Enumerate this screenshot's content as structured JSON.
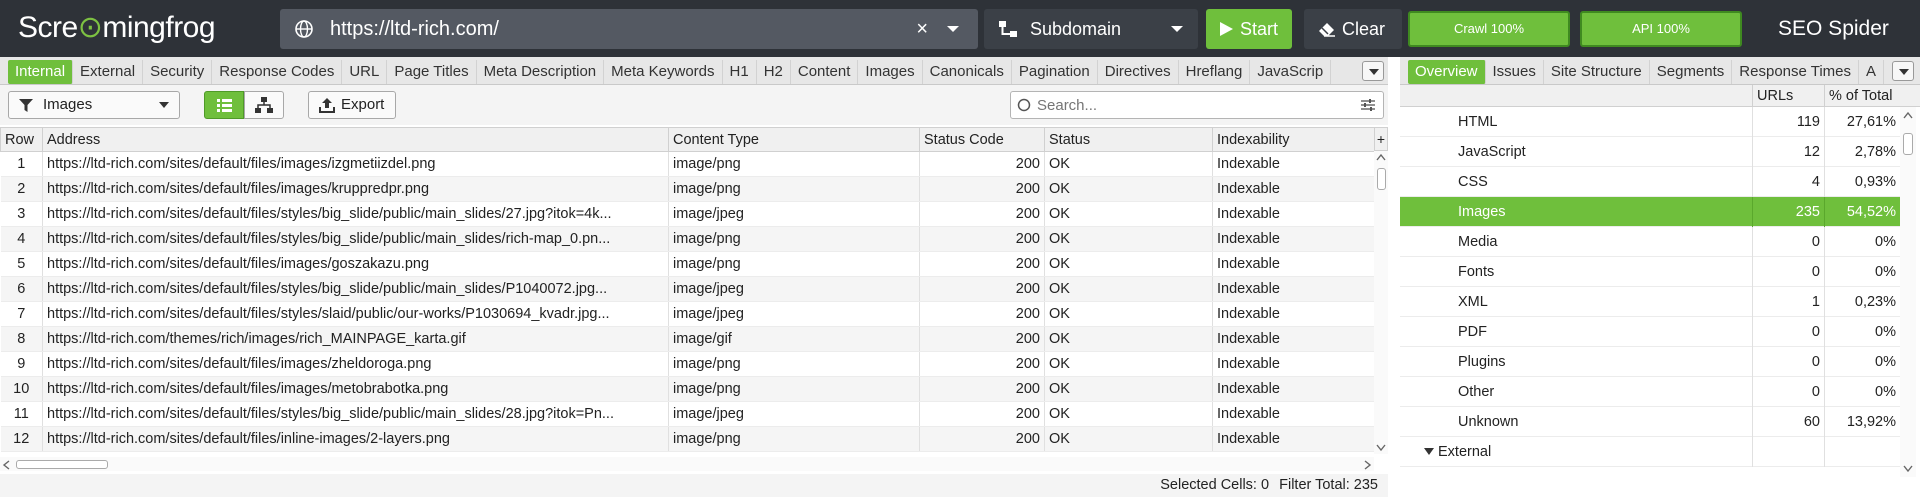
{
  "app": {
    "logo_prefix": "Scre",
    "logo_frog": "⊙",
    "logo_suffix": "mingfrog",
    "product": "SEO Spider",
    "accent_color": "#6fbf3c"
  },
  "url_bar": {
    "url": "https://ltd-rich.com/",
    "clear_icon": "×"
  },
  "mode": {
    "label": "Subdomain"
  },
  "buttons": {
    "start": "Start",
    "clear": "Clear",
    "export": "Export"
  },
  "progress": {
    "crawl_label": "Crawl 100%",
    "crawl_value": 100,
    "api_label": "API 100%",
    "api_value": 100
  },
  "left_tabs": [
    {
      "label": "Internal",
      "active": true
    },
    {
      "label": "External"
    },
    {
      "label": "Security"
    },
    {
      "label": "Response Codes"
    },
    {
      "label": "URL"
    },
    {
      "label": "Page Titles"
    },
    {
      "label": "Meta Description"
    },
    {
      "label": "Meta Keywords"
    },
    {
      "label": "H1"
    },
    {
      "label": "H2"
    },
    {
      "label": "Content"
    },
    {
      "label": "Images"
    },
    {
      "label": "Canonicals"
    },
    {
      "label": "Pagination"
    },
    {
      "label": "Directives"
    },
    {
      "label": "Hreflang"
    },
    {
      "label": "JavaScrip"
    }
  ],
  "right_tabs": [
    {
      "label": "Overview",
      "active": true
    },
    {
      "label": "Issues"
    },
    {
      "label": "Site Structure"
    },
    {
      "label": "Segments"
    },
    {
      "label": "Response Times"
    },
    {
      "label": "A"
    }
  ],
  "toolbar": {
    "filter": "Images",
    "search_placeholder": "Search..."
  },
  "table": {
    "columns": [
      "Row",
      "Address",
      "Content Type",
      "Status Code",
      "Status",
      "Indexability"
    ],
    "plus": "+",
    "rows": [
      [
        "1",
        "https://ltd-rich.com/sites/default/files/images/izgmetiizdel.png",
        "image/png",
        "200",
        "OK",
        "Indexable"
      ],
      [
        "2",
        "https://ltd-rich.com/sites/default/files/images/kruppredpr.png",
        "image/png",
        "200",
        "OK",
        "Indexable"
      ],
      [
        "3",
        "https://ltd-rich.com/sites/default/files/styles/big_slide/public/main_slides/27.jpg?itok=4k...",
        "image/jpeg",
        "200",
        "OK",
        "Indexable"
      ],
      [
        "4",
        "https://ltd-rich.com/sites/default/files/styles/big_slide/public/main_slides/rich-map_0.pn...",
        "image/png",
        "200",
        "OK",
        "Indexable"
      ],
      [
        "5",
        "https://ltd-rich.com/sites/default/files/images/goszakazu.png",
        "image/png",
        "200",
        "OK",
        "Indexable"
      ],
      [
        "6",
        "https://ltd-rich.com/sites/default/files/styles/big_slide/public/main_slides/P1040072.jpg...",
        "image/jpeg",
        "200",
        "OK",
        "Indexable"
      ],
      [
        "7",
        "https://ltd-rich.com/sites/default/files/styles/slaid/public/our-works/P1030694_kvadr.jpg...",
        "image/jpeg",
        "200",
        "OK",
        "Indexable"
      ],
      [
        "8",
        "https://ltd-rich.com/themes/rich/images/rich_MAINPAGE_karta.gif",
        "image/gif",
        "200",
        "OK",
        "Indexable"
      ],
      [
        "9",
        "https://ltd-rich.com/sites/default/files/images/zheldoroga.png",
        "image/png",
        "200",
        "OK",
        "Indexable"
      ],
      [
        "10",
        "https://ltd-rich.com/sites/default/files/images/metobrabotka.png",
        "image/png",
        "200",
        "OK",
        "Indexable"
      ],
      [
        "11",
        "https://ltd-rich.com/sites/default/files/styles/big_slide/public/main_slides/28.jpg?itok=Pn...",
        "image/jpeg",
        "200",
        "OK",
        "Indexable"
      ],
      [
        "12",
        "https://ltd-rich.com/sites/default/files/inline-images/2-layers.png",
        "image/png",
        "200",
        "OK",
        "Indexable"
      ]
    ]
  },
  "status_bar": {
    "selected_label": "Selected Cells:",
    "selected_value": "0",
    "filter_label": "Filter Total:",
    "filter_value": "235"
  },
  "overview": {
    "columns": [
      "URLs",
      "% of Total"
    ],
    "rows": [
      {
        "name": "HTML",
        "urls": "119",
        "pct": "27,61%"
      },
      {
        "name": "JavaScript",
        "urls": "12",
        "pct": "2,78%"
      },
      {
        "name": "CSS",
        "urls": "4",
        "pct": "0,93%"
      },
      {
        "name": "Images",
        "urls": "235",
        "pct": "54,52%",
        "selected": true
      },
      {
        "name": "Media",
        "urls": "0",
        "pct": "0%"
      },
      {
        "name": "Fonts",
        "urls": "0",
        "pct": "0%"
      },
      {
        "name": "XML",
        "urls": "1",
        "pct": "0,23%"
      },
      {
        "name": "PDF",
        "urls": "0",
        "pct": "0%"
      },
      {
        "name": "Plugins",
        "urls": "0",
        "pct": "0%"
      },
      {
        "name": "Other",
        "urls": "0",
        "pct": "0%"
      },
      {
        "name": "Unknown",
        "urls": "60",
        "pct": "13,92%"
      }
    ],
    "group": "External"
  }
}
